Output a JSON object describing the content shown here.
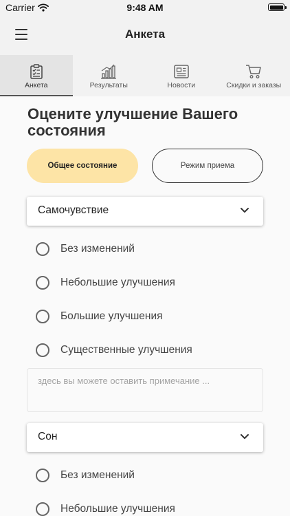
{
  "status_bar": {
    "carrier": "Carrier",
    "time": "9:48 AM"
  },
  "nav": {
    "title": "Анкета"
  },
  "tabs": [
    {
      "label": "Анкета",
      "icon": "clipboard-icon",
      "active": true
    },
    {
      "label": "Результаты",
      "icon": "bar-chart-icon",
      "active": false
    },
    {
      "label": "Новости",
      "icon": "newspaper-icon",
      "active": false
    },
    {
      "label": "Скидки и заказы",
      "icon": "cart-icon",
      "active": false
    }
  ],
  "main": {
    "heading": "Оцените улучшение Вашего состояния",
    "mode_buttons": [
      {
        "label": "Общее состояние",
        "selected": true
      },
      {
        "label": "Режим приема",
        "selected": false
      }
    ],
    "sections": [
      {
        "title": "Самочувствие",
        "options": [
          "Без изменений",
          "Небольшие улучшения",
          "Большие улучшения",
          "Существенные улучшения"
        ],
        "note_placeholder": "здесь вы можете оставить примечание ..."
      },
      {
        "title": "Сон",
        "options": [
          "Без изменений",
          "Небольшие улучшения"
        ]
      }
    ]
  },
  "colors": {
    "accent": "#fde4a6",
    "background": "#fafafa",
    "bar": "#f2f2f2",
    "text": "#333333"
  }
}
